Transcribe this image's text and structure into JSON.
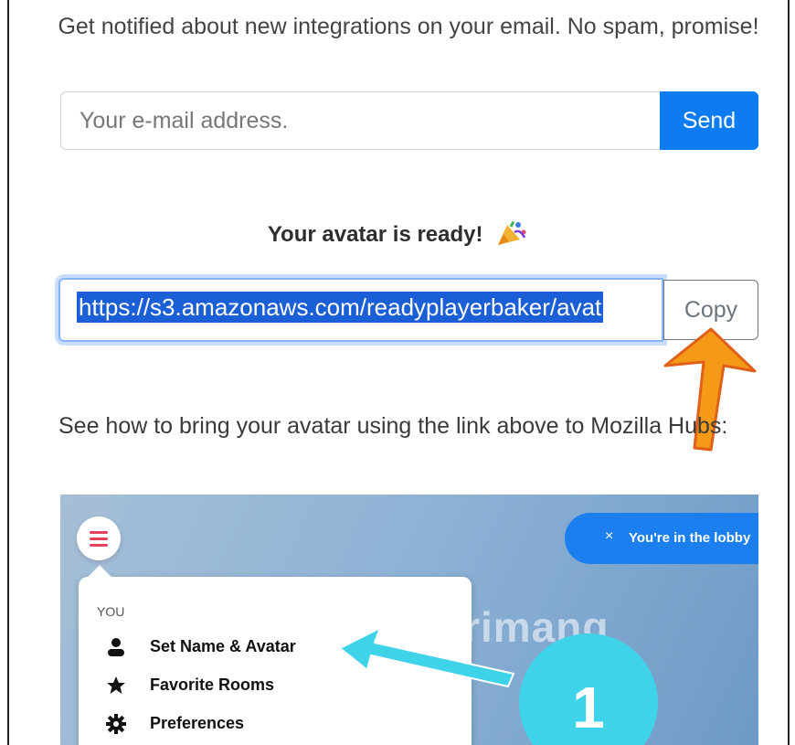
{
  "newsletter": {
    "text": "Get notified about new integrations on your email. No spam, promise!",
    "email_placeholder": "Your e-mail address.",
    "send_label": "Send"
  },
  "avatar": {
    "title": "Your avatar is ready!",
    "url": "https://s3.amazonaws.com/readyplayerbaker/avat",
    "copy_label": "Copy"
  },
  "instructions": {
    "text": "See how to bring your avatar using the link above to Mozilla Hubs:"
  },
  "hubs_screenshot": {
    "lobby_text": "You're in the lobby",
    "close_symbol": "×",
    "section_label": "YOU",
    "menu_items": [
      {
        "label": "Set Name & Avatar",
        "icon": "person-icon"
      },
      {
        "label": "Favorite Rooms",
        "icon": "star-icon"
      },
      {
        "label": "Preferences",
        "icon": "gear-icon"
      }
    ],
    "step_number": "1",
    "watermark": "uantrimang"
  },
  "colors": {
    "accent": "#0d7cf2",
    "selection": "#1a5fd6",
    "focus_ring": "#86b7fe",
    "arrow": "#f59a16",
    "hubs_pink": "#e5425c",
    "hubs_blue": "#1b7ff0",
    "step_cyan": "#3fd3ea"
  }
}
